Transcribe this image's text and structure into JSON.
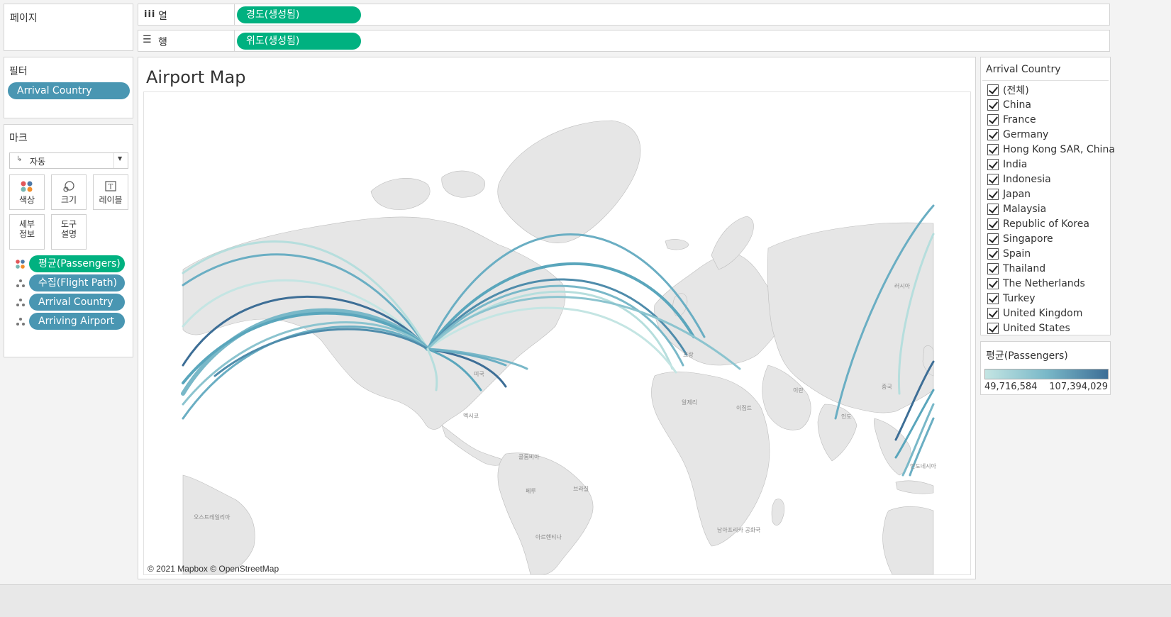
{
  "shelves": {
    "pages_label": "페이지",
    "columns_label": "열",
    "rows_label": "행",
    "columns_pill": "경도(생성됨)",
    "rows_pill": "위도(생성됨)"
  },
  "filters": {
    "title": "필터",
    "items": [
      "Arrival Country"
    ]
  },
  "marks": {
    "title": "마크",
    "type": "자동",
    "buttons": {
      "color": "색상",
      "size": "크기",
      "label": "레이블",
      "detail_1": "세부",
      "detail_2": "정보",
      "tooltip_1": "도구",
      "tooltip_2": "설명"
    },
    "fields": [
      {
        "label": "평균(Passengers)",
        "color": "#00b180",
        "icon": "color-dots-icon"
      },
      {
        "label": "수집(Flight Path)",
        "color": "#4996b2",
        "icon": "detail-dots-icon"
      },
      {
        "label": "Arrival Country",
        "color": "#4996b2",
        "icon": "detail-dots-icon"
      },
      {
        "label": "Arriving Airport",
        "color": "#4996b2",
        "icon": "detail-dots-icon"
      }
    ]
  },
  "view": {
    "title": "Airport Map",
    "attribution": "© 2021 Mapbox © OpenStreetMap",
    "map_labels": [
      "러시아",
      "중국",
      "인도",
      "이란",
      "이집트",
      "알제리",
      "프랑",
      "멕시코",
      "미국",
      "페루",
      "브라질",
      "콜롬비아",
      "아르헨티나",
      "오스트레일리아",
      "남아프리카 공화국",
      "인도네시아"
    ]
  },
  "filter_card": {
    "title": "Arrival Country",
    "items": [
      "(전체)",
      "China",
      "France",
      "Germany",
      "Hong Kong SAR, China",
      "India",
      "Indonesia",
      "Japan",
      "Malaysia",
      "Republic of Korea",
      "Singapore",
      "Spain",
      "Thailand",
      "The Netherlands",
      "Turkey",
      "United Kingdom",
      "United States"
    ]
  },
  "color_legend": {
    "title": "평균(Passengers)",
    "min_label": "49,716,584",
    "max_label": "107,394,029",
    "color_low": "#c4e5e3",
    "color_high": "#3d6e96"
  }
}
